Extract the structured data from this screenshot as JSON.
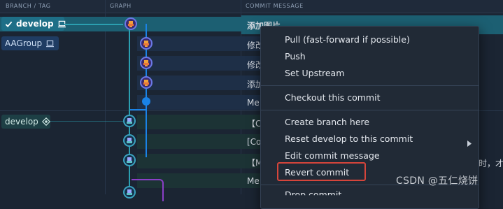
{
  "header": {
    "branch_tag": "BRANCH / TAG",
    "graph": "GRAPH",
    "commit_message": "COMMIT MESSAGE"
  },
  "branches": {
    "develop_active": "develop",
    "aagroup": "AAGroup",
    "develop_remote": "develop"
  },
  "commits": [
    {
      "message": "添加图片"
    },
    {
      "message": "修改"
    },
    {
      "message": "修改"
    },
    {
      "message": "添加"
    },
    {
      "message": "Me"
    },
    {
      "message": "【C"
    },
    {
      "message": "[Co"
    },
    {
      "message": "【M"
    },
    {
      "message": "Me"
    }
  ],
  "trailing_text": "时，才",
  "context_menu": {
    "items": [
      {
        "label": "Pull (fast-forward if possible)"
      },
      {
        "label": "Push"
      },
      {
        "label": "Set Upstream"
      },
      {
        "label": "Checkout this commit"
      },
      {
        "label": "Create branch here"
      },
      {
        "label": "Reset develop to this commit"
      },
      {
        "label": "Edit commit message"
      },
      {
        "label": "Revert commit"
      },
      {
        "label": "Drop commit"
      }
    ]
  },
  "watermark": "CSDN @五仁烧饼",
  "colors": {
    "accent_teal": "#1e6f87",
    "highlight": "#d6453b",
    "graph_line_blue": "#1a82e6",
    "graph_line_teal": "#2b9fb0",
    "graph_line_purple": "#8a3fc7"
  }
}
